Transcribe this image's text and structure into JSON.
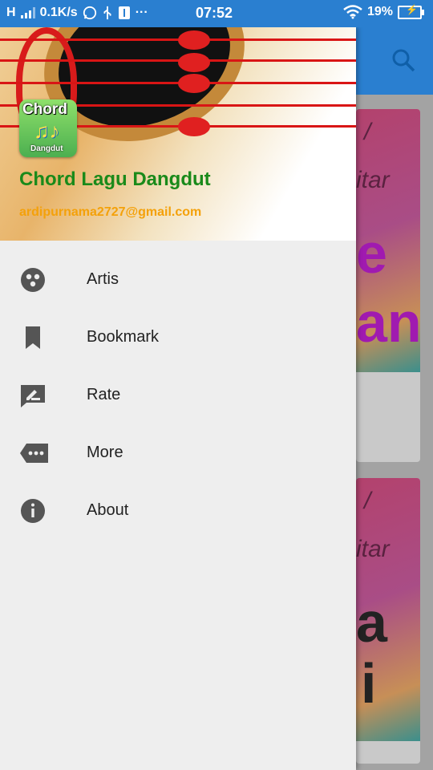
{
  "status_bar": {
    "network": "H",
    "speed": "0.1K/s",
    "notif_icons": [
      "whatsapp-icon",
      "usb-icon",
      "usb-debug-icon"
    ],
    "more": "···",
    "time": "07:52",
    "battery": "19%"
  },
  "drawer": {
    "logo_top": "Chord",
    "logo_bottom": "Dangdut",
    "logo_notes": "♫♪",
    "app_name": "Chord Lagu Dangdut",
    "email": "ardipurnama2727@gmail.com",
    "items": [
      {
        "label": "Artis",
        "icon": "artist-icon"
      },
      {
        "label": "Bookmark",
        "icon": "bookmark-icon"
      },
      {
        "label": "Rate",
        "icon": "rate-icon"
      },
      {
        "label": "More",
        "icon": "more-icon"
      },
      {
        "label": "About",
        "icon": "info-icon"
      }
    ]
  },
  "background": {
    "card1": {
      "line1": "/",
      "line2": "itar",
      "line3": "e",
      "line4": "an"
    },
    "card2": {
      "line1": "/",
      "line2": "itar",
      "line3": "a",
      "line4": "i"
    }
  },
  "colors": {
    "primary": "#2a7fd0",
    "app_name": "#1a8a1a",
    "email": "#f4a10a",
    "drawer_bg": "#eeeeee",
    "icon": "#555555"
  }
}
